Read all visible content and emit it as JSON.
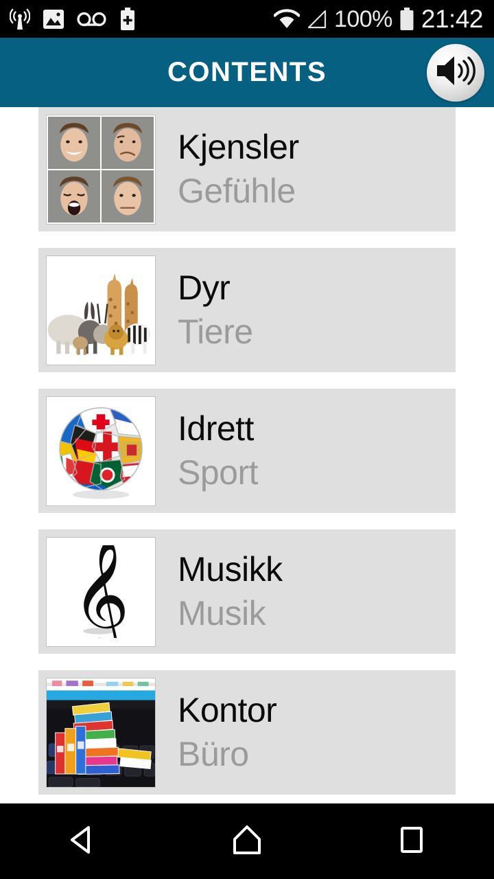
{
  "status_bar": {
    "left_icons": [
      "cell-tower-icon",
      "photo-icon",
      "voicemail-icon",
      "battery-plus-icon"
    ],
    "wifi_icon": "wifi-icon",
    "signal_icon": "signal-triangle-icon",
    "battery_percent": "100%",
    "battery_icon": "battery-full-icon",
    "time": "21:42"
  },
  "app_bar": {
    "title": "CONTENTS",
    "speaker_icon": "speaker-volume-icon",
    "background_color": "#056081",
    "title_color": "#ffffff"
  },
  "list": {
    "card_color": "#dfdfdf",
    "title_color": "#0a0a0a",
    "subtitle_color": "#9b9b9b",
    "items": [
      {
        "title": "Kjensler",
        "subtitle": "Gefühle",
        "thumb": "faces-emotions-grid-image"
      },
      {
        "title": "Dyr",
        "subtitle": "Tiere",
        "thumb": "african-animals-group-image"
      },
      {
        "title": "Idrett",
        "subtitle": "Sport",
        "thumb": "flags-soccer-ball-image"
      },
      {
        "title": "Musikk",
        "subtitle": "Musik",
        "thumb": "treble-clef-image"
      },
      {
        "title": "Kontor",
        "subtitle": "Büro",
        "thumb": "binders-on-keyboard-image"
      }
    ]
  },
  "nav_bar": {
    "back_icon": "back-triangle-icon",
    "home_icon": "home-pentagon-icon",
    "recents_icon": "recents-square-icon"
  }
}
